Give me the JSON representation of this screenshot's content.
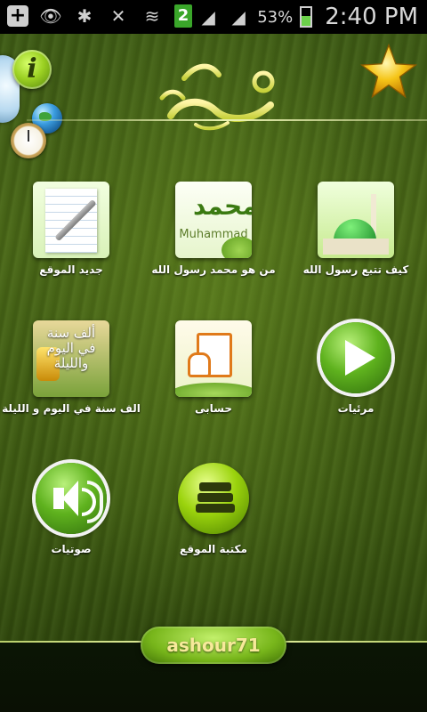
{
  "status_bar": {
    "notification_count": "2",
    "battery": "53%",
    "time": "2:40 PM"
  },
  "header": {
    "calligraphy_logo": "محمد الحبيب صلى الله عليه وسلم",
    "icons": [
      "info-icon",
      "globe-icon",
      "clock-icon",
      "star-icon"
    ]
  },
  "menu": {
    "items": [
      {
        "label": "كيف تتبع رسول الله",
        "icon": "mosque-icon"
      },
      {
        "label": "من هو محمد رسول الله",
        "icon": "muhammad-calligraphy-icon",
        "tile_text": "Muhammad",
        "tile_calligraphy": "محمد"
      },
      {
        "label": "جديد الموقع",
        "icon": "notepad-pen-icon"
      },
      {
        "label": "مرئيات",
        "icon": "play-icon"
      },
      {
        "label": "حسابى",
        "icon": "account-document-icon"
      },
      {
        "label": "الف سنة في اليوم و الليلة",
        "icon": "book-cover-icon",
        "tile_text": "ألف سنة في اليوم والليلة"
      },
      {
        "label": "مكتبة الموقع",
        "icon": "books-icon"
      },
      {
        "label": "صوتيات",
        "icon": "speaker-icon"
      }
    ]
  },
  "footer": {
    "username": "ashour71"
  },
  "colors": {
    "background": "#4b6a17",
    "accent": "#78b61b",
    "username_text": "#f7e99a"
  }
}
